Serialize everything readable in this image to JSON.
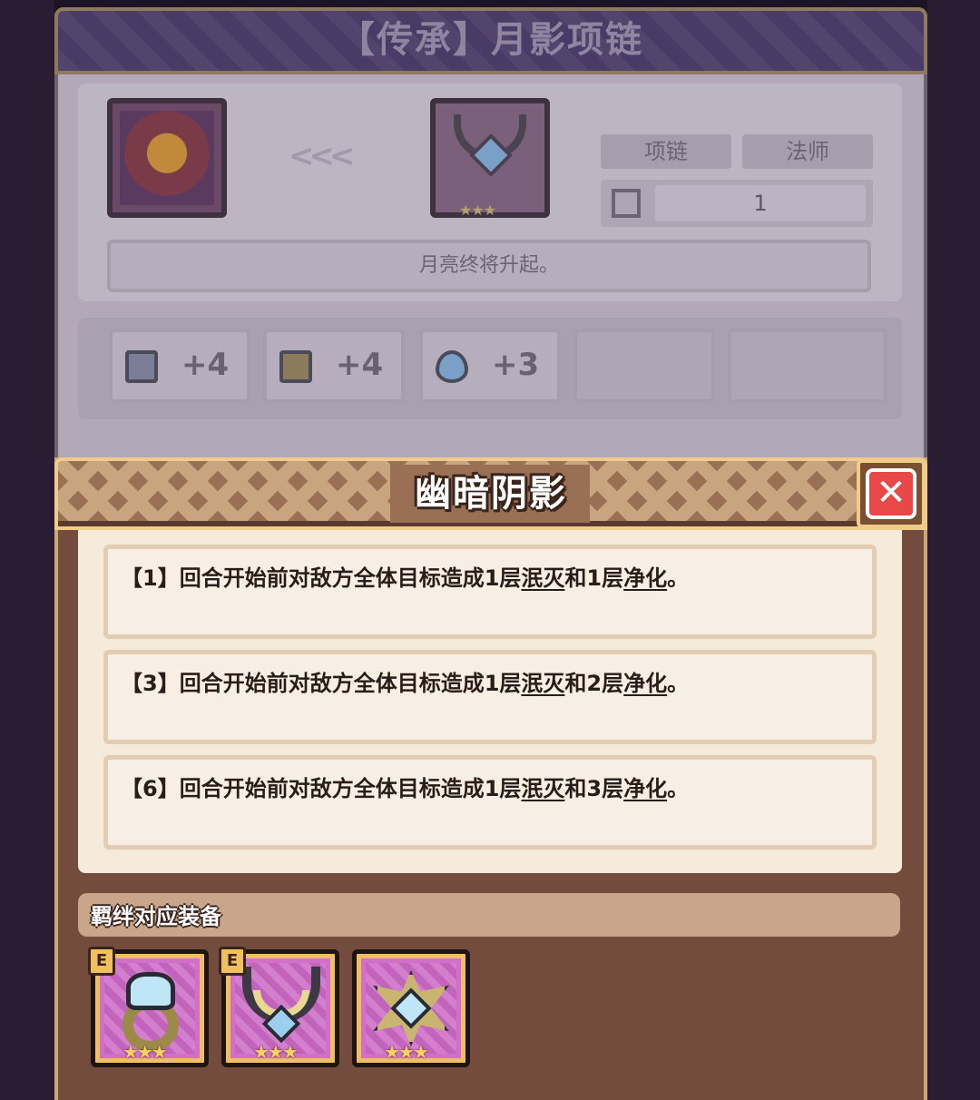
{
  "background_panel": {
    "title": "【传承】月影项链",
    "arrows": "<<<",
    "tags": [
      "项链",
      "法师"
    ],
    "number_value": "1",
    "description": "月亮终将升起。",
    "stats": [
      {
        "icon": "book-icon",
        "value": "+4"
      },
      {
        "icon": "boot-icon",
        "value": "+4"
      },
      {
        "icon": "water-drop-icon",
        "value": "+3"
      }
    ],
    "item_stars": "★★★"
  },
  "dialog": {
    "title": "幽暗阴影",
    "close_label": "✕",
    "effects": [
      {
        "prefix": "【1】回合开始前对敌方全体目标造成1层",
        "term1": "泯灭",
        "mid": "和1层",
        "term2": "净化",
        "suffix": "。"
      },
      {
        "prefix": "【3】回合开始前对敌方全体目标造成1层",
        "term1": "泯灭",
        "mid": "和2层",
        "term2": "净化",
        "suffix": "。"
      },
      {
        "prefix": "【6】回合开始前对敌方全体目标造成1层",
        "term1": "泯灭",
        "mid": "和3层",
        "term2": "净化",
        "suffix": "。"
      }
    ],
    "bond_label": "羁绊对应装备",
    "equipment": [
      {
        "icon": "ring-icon",
        "badge": "E",
        "stars": "★★★"
      },
      {
        "icon": "necklace-icon",
        "badge": "E",
        "stars": "★★★"
      },
      {
        "icon": "star-amulet-icon",
        "badge": "",
        "stars": "★★★"
      }
    ]
  },
  "colors": {
    "dialog_bg": "#744c3e",
    "accent_gold": "#f0cc88",
    "close_red": "#e84848",
    "item_purple": "#d070c8"
  }
}
